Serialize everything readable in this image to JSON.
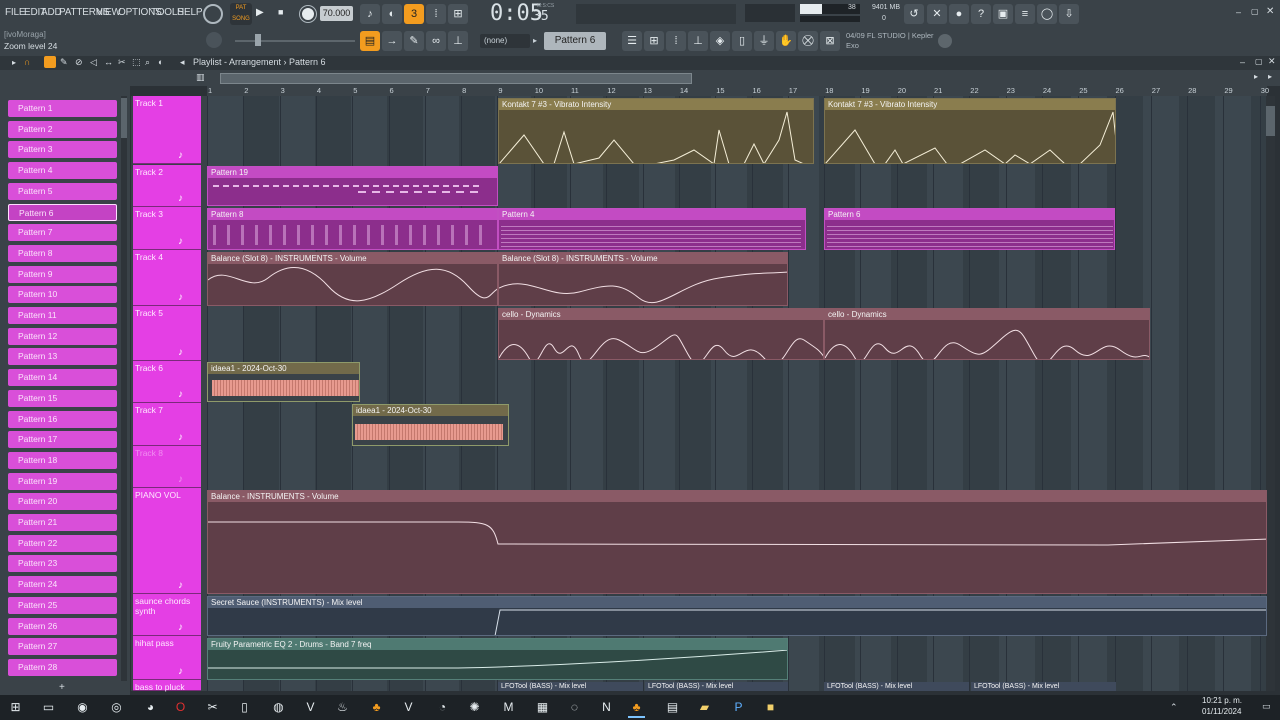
{
  "menu": [
    "FILE",
    "EDIT",
    "ADD",
    "PATTERNS",
    "VIEW",
    "OPTIONS",
    "TOOLS",
    "HELP"
  ],
  "transport": {
    "tempo": "70.000",
    "time": "0:05",
    "time_small": "35",
    "time_label": "M:S:CS",
    "pat_song": "PAT SONG"
  },
  "cpu": {
    "mem": "9401 MB",
    "voices": "38",
    "cpu_val": "0"
  },
  "hint": {
    "title": "[ivoMoraga]",
    "text": "Zoom level 24"
  },
  "toolbar2": {
    "none_select": "(none)",
    "pattern_select": "Pattern 6"
  },
  "news": {
    "line1": "04/09  FL STUDIO | Kepler",
    "line2": "Exo"
  },
  "playlist": {
    "breadcrumb": "Playlist - Arrangement › Pattern 6"
  },
  "ruler_numbers": [
    "1",
    "2",
    "3",
    "4",
    "5",
    "6",
    "7",
    "8",
    "9",
    "10",
    "11",
    "12",
    "13",
    "14",
    "15",
    "16",
    "17",
    "18",
    "19",
    "20",
    "21",
    "22",
    "23",
    "24",
    "25",
    "26",
    "27",
    "28",
    "29",
    "30"
  ],
  "patterns": [
    "Pattern 1",
    "Pattern 2",
    "Pattern 3",
    "Pattern 4",
    "Pattern 5",
    "Pattern 6",
    "Pattern 7",
    "Pattern 8",
    "Pattern 9",
    "Pattern 10",
    "Pattern 11",
    "Pattern 12",
    "Pattern 13",
    "Pattern 14",
    "Pattern 15",
    "Pattern 16",
    "Pattern 17",
    "Pattern 18",
    "Pattern 19",
    "Pattern 20",
    "Pattern 21",
    "Pattern 22",
    "Pattern 23",
    "Pattern 24",
    "Pattern 25",
    "Pattern 26",
    "Pattern 27",
    "Pattern 28"
  ],
  "selected_pattern": "Pattern 6",
  "tracks": [
    "Track 1",
    "Track 2",
    "Track 3",
    "Track 4",
    "Track 5",
    "Track 6",
    "Track 7",
    "Track 8",
    "PIANO VOL",
    "saunce chords synth",
    "hihat pass",
    "bass to pluck"
  ],
  "clips": {
    "k1": "Kontakt 7 #3 - Vibrato Intensity",
    "k2": "Kontakt 7 #3 - Vibrato Intensity",
    "p19": "Pattern 19",
    "p8": "Pattern 8",
    "p4": "Pattern 4",
    "p6": "Pattern 6",
    "bal1": "Balance (Slot 8) - INSTRUMENTS - Volume",
    "bal2": "Balance (Slot 8) - INSTRUMENTS - Volume",
    "cello1": "cello - Dynamics",
    "cello2": "cello - Dynamics",
    "aud1": "idaea1 - 2024-Oct-30",
    "aud2": "idaea1 - 2024-Oct-30",
    "pianovol": "Balance - INSTRUMENTS - Volume",
    "sauce": "Secret Sauce (INSTRUMENTS) - Mix level",
    "eq": "Fruity Parametric EQ 2 - Drums - Band 7 freq",
    "lfo1": "LFOTool (BASS) - Mix level",
    "lfo2": "LFOTool (BASS) - Mix level",
    "lfo3": "LFOTool (BASS) - Mix level",
    "lfo4": "LFOTool (BASS) - Mix level"
  },
  "clock": {
    "time": "10:21 p. m.",
    "date": "01/11/2024"
  },
  "colors": {
    "pattern": "#d94fd9",
    "track_header": "#e43fe4",
    "automation": "#8a5a66",
    "kontakt": "#6b6446",
    "audio": "#d9847a",
    "accent": "#f39c1f"
  }
}
